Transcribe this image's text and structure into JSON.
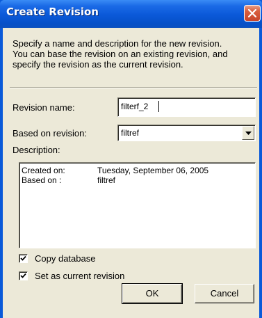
{
  "window": {
    "title": "Create Revision"
  },
  "intro": {
    "lines": [
      "Specify a name and description for the new revision.",
      "You can base the revision on an existing revision, and",
      "specify the revision as the current revision."
    ]
  },
  "form": {
    "revision_name_label": "Revision name:",
    "revision_name_value": "filterf_2",
    "based_on_label": "Based on revision:",
    "based_on_value": "filtref",
    "description_label": "Description:",
    "description": {
      "created_on_label": "Created on:",
      "created_on_value": "Tuesday, September 06, 2005",
      "based_on_label": "Based on :",
      "based_on_value": "filtref"
    }
  },
  "options": {
    "copy_database_label": "Copy database",
    "copy_database_checked": true,
    "set_current_label": "Set as current revision",
    "set_current_checked": true
  },
  "buttons": {
    "ok_label": "OK",
    "cancel_label": "Cancel"
  },
  "icons": {
    "close": "close-icon",
    "dropdown": "chevron-down-icon",
    "check": "check-icon"
  },
  "colors": {
    "titlebar": "#0a58d8",
    "close_button": "#d9603f",
    "dialog_background": "#ece9d8"
  }
}
